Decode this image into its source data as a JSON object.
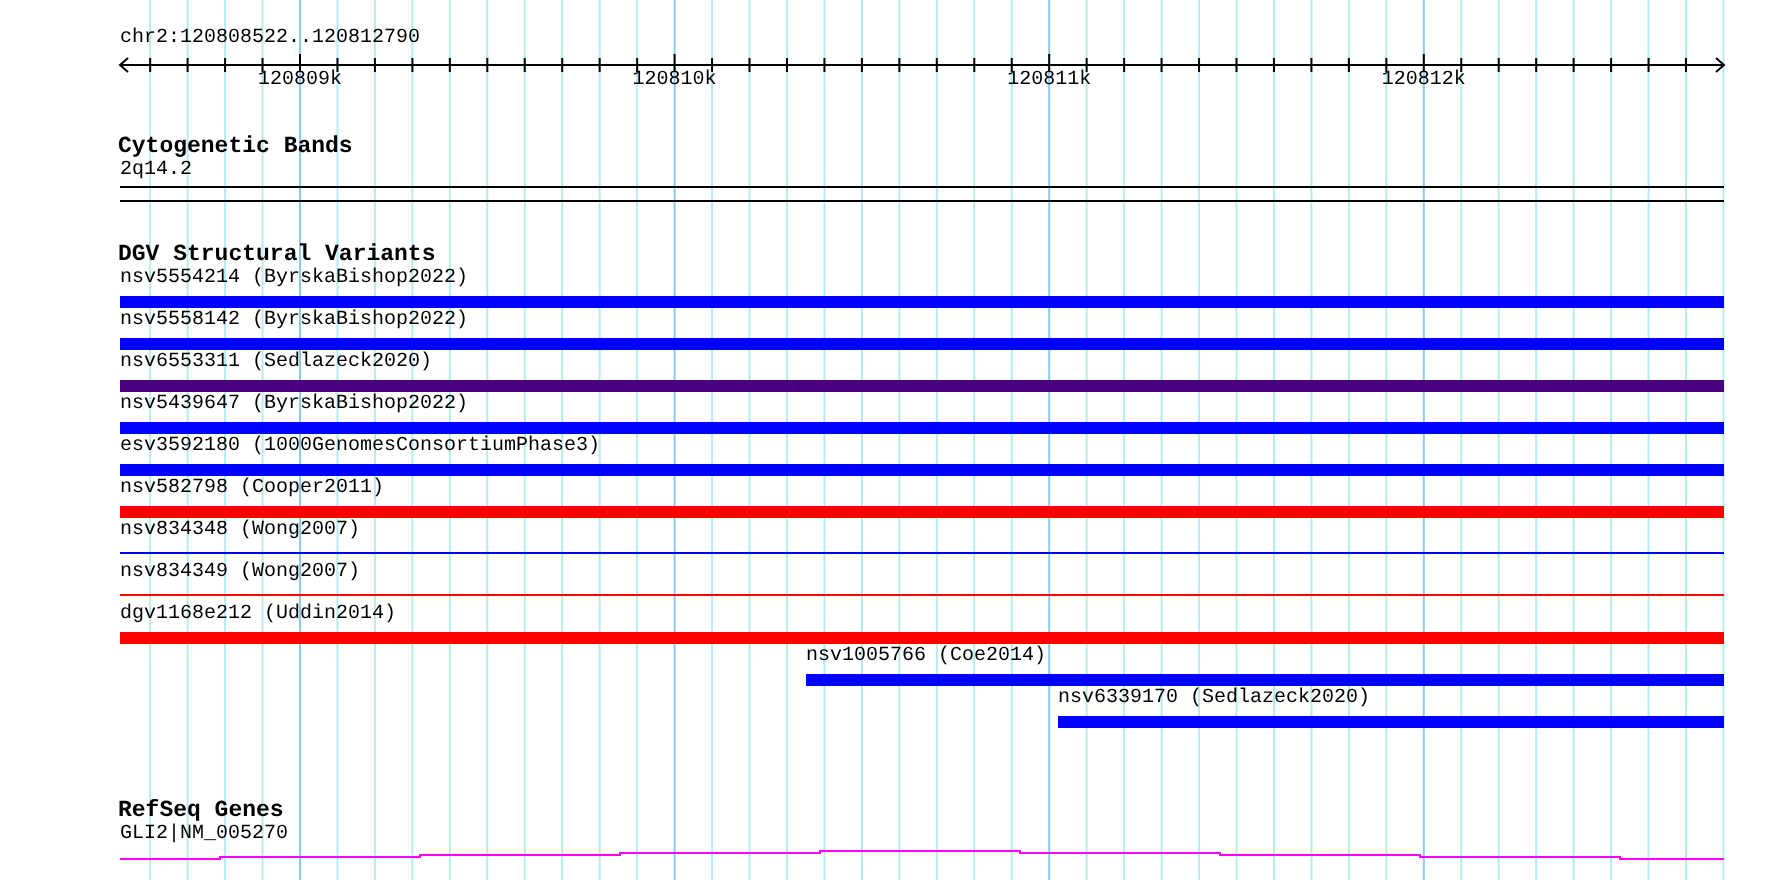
{
  "ruler": {
    "location": "chr2:120808522..120812790",
    "tick_labels": [
      "120809k",
      "120810k",
      "120811k",
      "120812k"
    ]
  },
  "tracks": [
    {
      "kind": "bands",
      "title": "Cytogenetic Bands",
      "features": [
        {
          "kind": "band",
          "label": "2q14.2"
        }
      ]
    },
    {
      "kind": "variants",
      "title": "DGV Structural Variants",
      "features": [
        {
          "kind": "bar",
          "label": "nsv5554214 (ByrskaBishop2022)",
          "color": "#0000ff"
        },
        {
          "kind": "bar",
          "label": "nsv5558142 (ByrskaBishop2022)",
          "color": "#0000ff"
        },
        {
          "kind": "bar",
          "label": "nsv6553311 (Sedlazeck2020)",
          "color": "#4b0082"
        },
        {
          "kind": "bar",
          "label": "nsv5439647 (ByrskaBishop2022)",
          "color": "#0000ff"
        },
        {
          "kind": "bar",
          "label": "esv3592180 (1000GenomesConsortiumPhase3)",
          "color": "#0000ff"
        },
        {
          "kind": "bar",
          "label": "nsv582798 (Cooper2011)",
          "color": "#ff0000"
        },
        {
          "kind": "line",
          "label": "nsv834348 (Wong2007)",
          "color": "#0000ff"
        },
        {
          "kind": "line",
          "label": "nsv834349 (Wong2007)",
          "color": "#ff0000"
        },
        {
          "kind": "bar",
          "label": "dgv1168e212 (Uddin2014)",
          "color": "#ff0000"
        },
        {
          "kind": "bar",
          "label": "nsv1005766 (Coe2014)",
          "color": "#0000ff"
        },
        {
          "kind": "bar",
          "label": "nsv6339170 (Sedlazeck2020)",
          "color": "#0000ff"
        }
      ]
    },
    {
      "kind": "genes",
      "title": "RefSeq Genes",
      "features": [
        {
          "kind": "gene",
          "label": "GLI2|NM_005270"
        }
      ]
    }
  ]
}
